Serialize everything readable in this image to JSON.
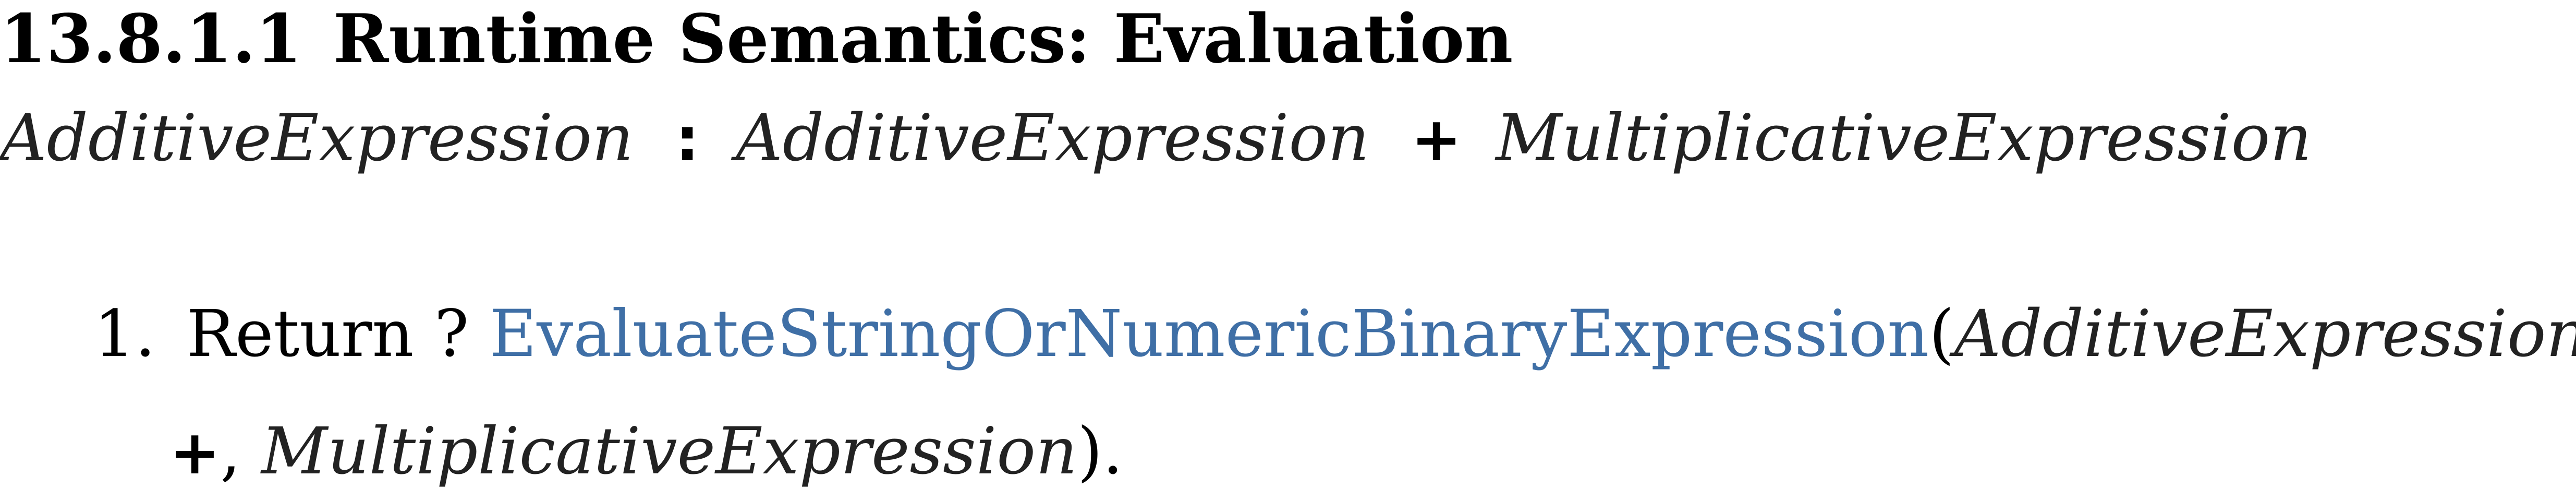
{
  "section": {
    "number": "13.8.1.1",
    "title": "Runtime Semantics: Evaluation"
  },
  "production": {
    "lhs": "AdditiveExpression",
    "colon": ":",
    "rhs_1": "AdditiveExpression",
    "operator": "+",
    "rhs_2": "MultiplicativeExpression"
  },
  "algorithm": {
    "step_number": "1.",
    "step_prefix": "Return ?",
    "operation_link": "EvaluateStringOrNumericBinaryExpression",
    "open_paren": "(",
    "arg_1": "AdditiveExpression",
    "comma_1": ",",
    "arg_2": "+",
    "comma_2": ",",
    "arg_3": "MultiplicativeExpression",
    "close": ")."
  }
}
